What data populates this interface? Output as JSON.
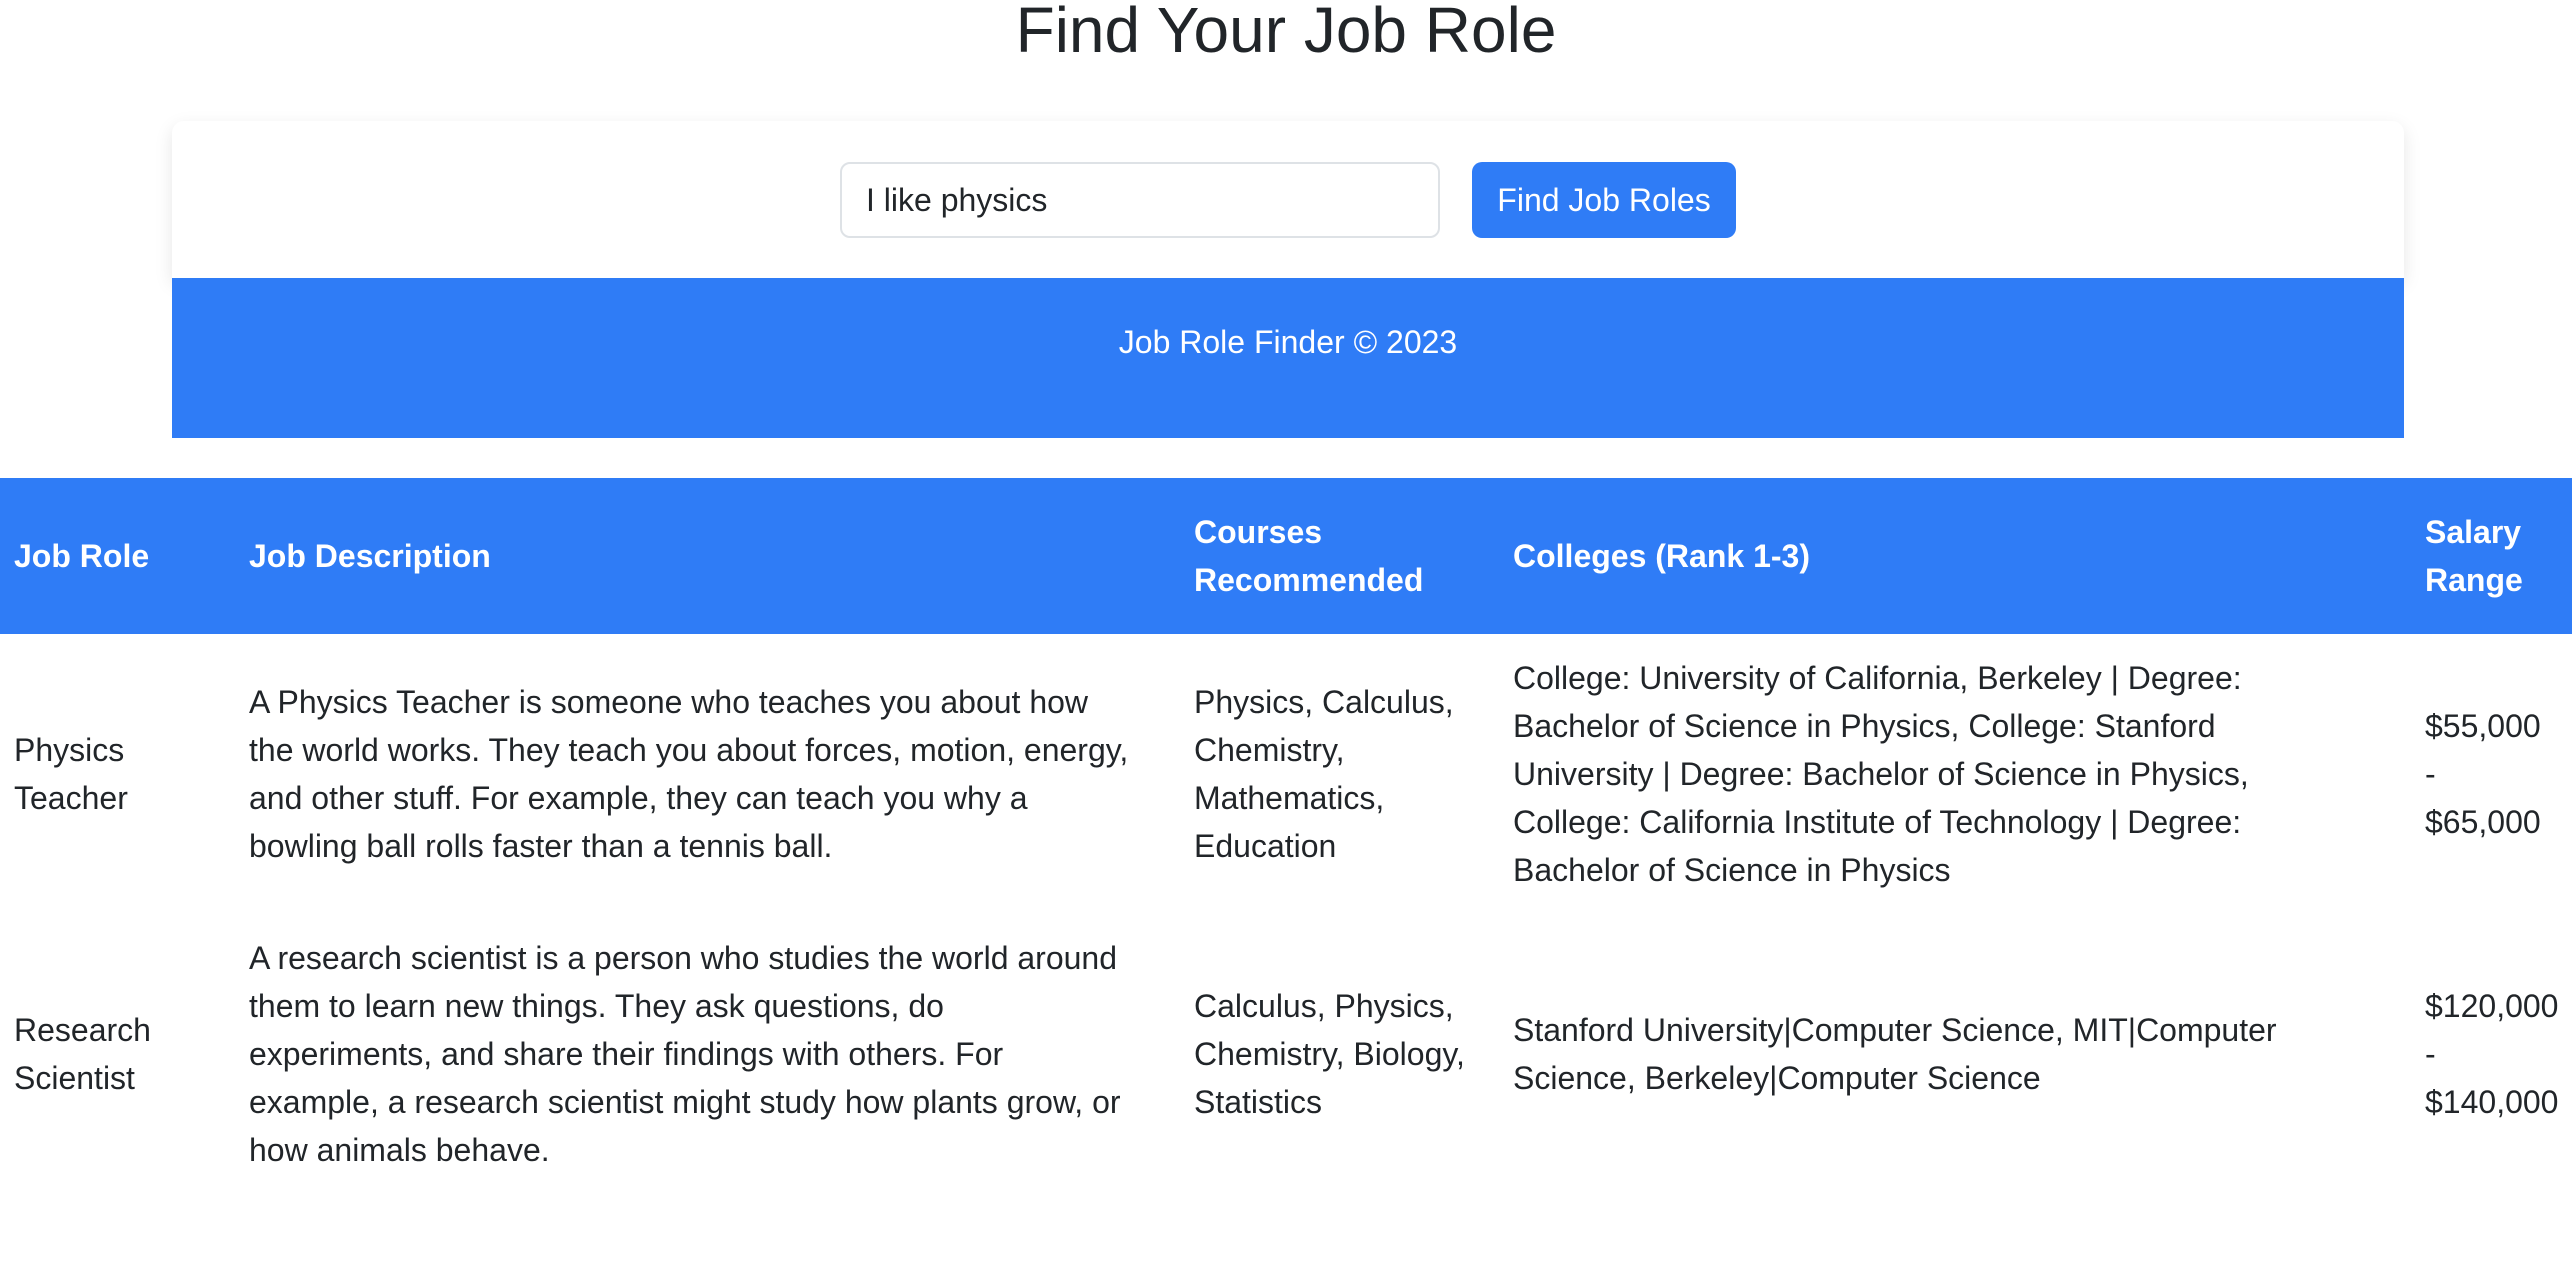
{
  "page": {
    "title": "Find Your Job Role"
  },
  "search": {
    "value": "I like physics",
    "button_label": "Find Job Roles"
  },
  "footer": {
    "text": "Job Role Finder © 2023"
  },
  "table": {
    "headers": {
      "job_role": "Job Role",
      "job_description": "Job Description",
      "courses": "Courses Recommended",
      "colleges": "Colleges (Rank 1-3)",
      "salary": "Salary Range"
    },
    "rows": [
      {
        "job_role": "Physics Teacher",
        "job_description": "A Physics Teacher is someone who teaches you about how the world works. They teach you about forces, motion, energy, and other stuff. For example, they can teach you why a bowling ball rolls faster than a tennis ball.",
        "courses": "Physics, Calculus, Chemistry, Mathematics, Education",
        "colleges": "College: University of California, Berkeley | Degree: Bachelor of Science in Physics, College: Stanford University | Degree: Bachelor of Science in Physics, College: California Institute of Technology | Degree: Bachelor of Science in Physics",
        "salary": "$55,000 - $65,000"
      },
      {
        "job_role": "Research Scientist",
        "job_description": "A research scientist is a person who studies the world around them to learn new things. They ask questions, do experiments, and share their findings with others. For example, a research scientist might study how plants grow, or how animals behave.",
        "courses": "Calculus, Physics, Chemistry, Biology, Statistics",
        "colleges": "Stanford University|Computer Science, MIT|Computer Science, Berkeley|Computer Science",
        "salary": "$120,000 - $140,000"
      }
    ]
  },
  "colors": {
    "primary": "#2f7cf6",
    "text": "#212529",
    "background": "#ffffff"
  }
}
